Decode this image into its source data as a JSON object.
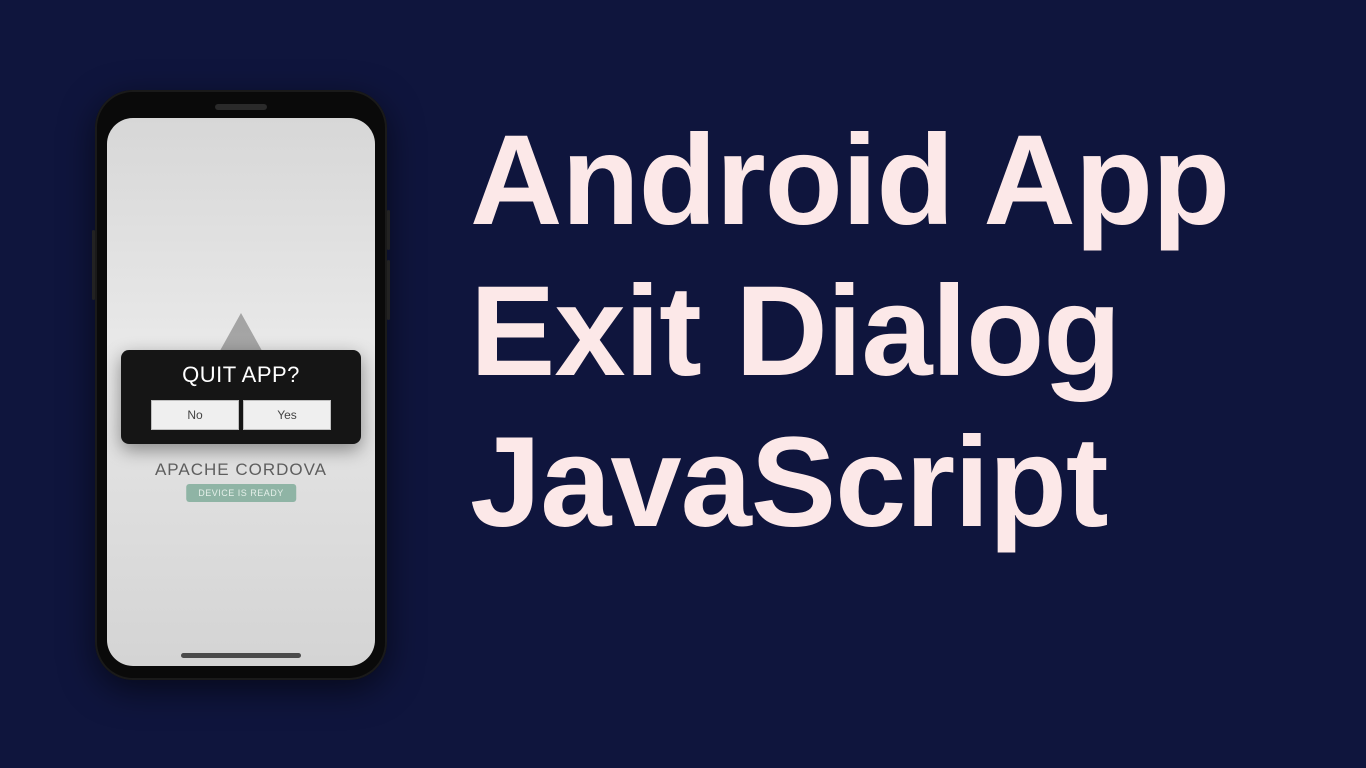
{
  "headline": {
    "line1": "Android App",
    "line2": "Exit Dialog",
    "line3": "JavaScript"
  },
  "dialog": {
    "title": "QUIT APP?",
    "no_label": "No",
    "yes_label": "Yes"
  },
  "app": {
    "framework_label": "APACHE CORDOVA",
    "status_label": "DEVICE IS READY"
  }
}
